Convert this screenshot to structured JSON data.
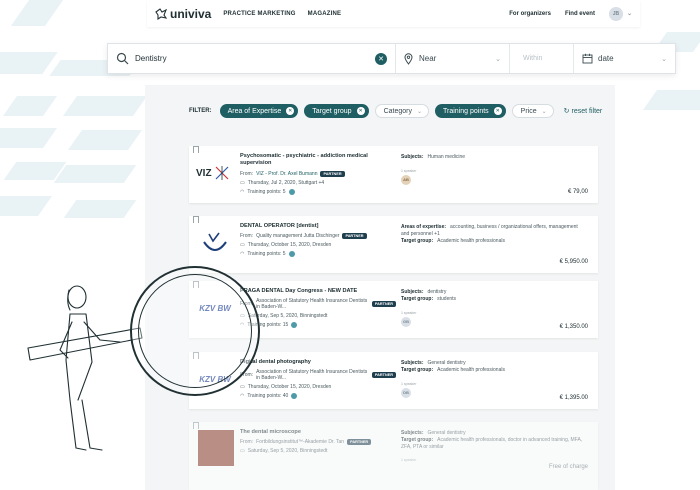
{
  "nav": {
    "logo": "univiva",
    "links": [
      "PRACTICE MARKETING",
      "MAGAZINE"
    ],
    "right_links": [
      "For organizers",
      "Find event"
    ],
    "avatar_initials": "JB"
  },
  "search": {
    "query": "Dentistry",
    "near_placeholder": "Near",
    "within_placeholder": "Within",
    "date_placeholder": "date"
  },
  "filter": {
    "label": "FILTER:",
    "chips": [
      {
        "label": "Area of Expertise",
        "active": true
      },
      {
        "label": "Target group",
        "active": true
      },
      {
        "label": "Category",
        "active": false
      },
      {
        "label": "Training points",
        "active": true
      },
      {
        "label": "Price",
        "active": false
      }
    ],
    "reset_label": "reset filter"
  },
  "events": [
    {
      "logo_text": "VIZ",
      "title": "Psychosomatic - psychiatric - addiction medical supervision",
      "from_prefix": "From:",
      "from": "VIZ - Prof. Dr. Axel Bumann",
      "partner": "PARTNER",
      "date": "Thursday, Jul 2, 2020, Stuttgart +4",
      "points": "Training points: 5",
      "meta": [
        {
          "k": "Subjects:",
          "v": "Human medicine"
        }
      ],
      "speaker_label": "1 speaker",
      "speaker_initials": "AB",
      "price": "€ 79,00"
    },
    {
      "logo_text": "",
      "title": "DENTAL OPERATOR [dentist]",
      "from_prefix": "From:",
      "from": "Quality management Jutta Dischinger",
      "partner": "PARTNER",
      "date": "Thursday, October 15, 2020, Dresden",
      "points": "Training points: 5",
      "meta": [
        {
          "k": "Areas of expertise:",
          "v": "accounting, business / organizational offers, management and personnel +1"
        },
        {
          "k": "Target group:",
          "v": "Academic health professionals"
        }
      ],
      "speaker_label": "",
      "speaker_initials": "",
      "price": "€ 5,950.00"
    },
    {
      "logo_text": "KZV BW",
      "title": "PRAGA DENTAL Day Congress - NEW DATE",
      "from_prefix": "From:",
      "from": "Association of Statutory Health Insurance Dentists in Baden-W...",
      "partner": "PARTNER",
      "date": "Saturday, Sep 5, 2020, Binningstedt",
      "points": "Training points: 15",
      "meta": [
        {
          "k": "Subjects:",
          "v": "dentistry"
        },
        {
          "k": "Target group:",
          "v": "students"
        }
      ],
      "speaker_label": "1 speaker",
      "speaker_initials": "GB",
      "price": "€ 1,350.00"
    },
    {
      "logo_text": "KZV BW",
      "title": "Digital dental photography",
      "from_prefix": "From:",
      "from": "Association of Statutory Health Insurance Dentists in Baden-W...",
      "partner": "PARTNER",
      "date": "Thursday, October 15, 2020, Dresden",
      "points": "Training points: 40",
      "meta": [
        {
          "k": "Subjects:",
          "v": "General dentistry"
        },
        {
          "k": "Target group:",
          "v": "Academic health professionals"
        }
      ],
      "speaker_label": "1 speaker",
      "speaker_initials": "DB",
      "price": "€ 1,395.00"
    },
    {
      "logo_text": "",
      "title": "The dental microscope",
      "from_prefix": "From:",
      "from": "Fortbildungsinstitut™-Akademie Dr. Tan",
      "partner": "PARTNER",
      "date": "Saturday, Sep 5, 2020, Binningstedt",
      "points": "",
      "meta": [
        {
          "k": "Subjects:",
          "v": "General dentistry"
        },
        {
          "k": "Target group:",
          "v": "Academic health professionals, doctor in advanced training, MFA, ZFA, PTA or similar"
        }
      ],
      "speaker_label": "1 speaker",
      "speaker_initials": "",
      "price": "Free of charge"
    }
  ],
  "colors": {
    "accent": "#1f5f63",
    "bg_stripe": "#e9f2f5"
  }
}
